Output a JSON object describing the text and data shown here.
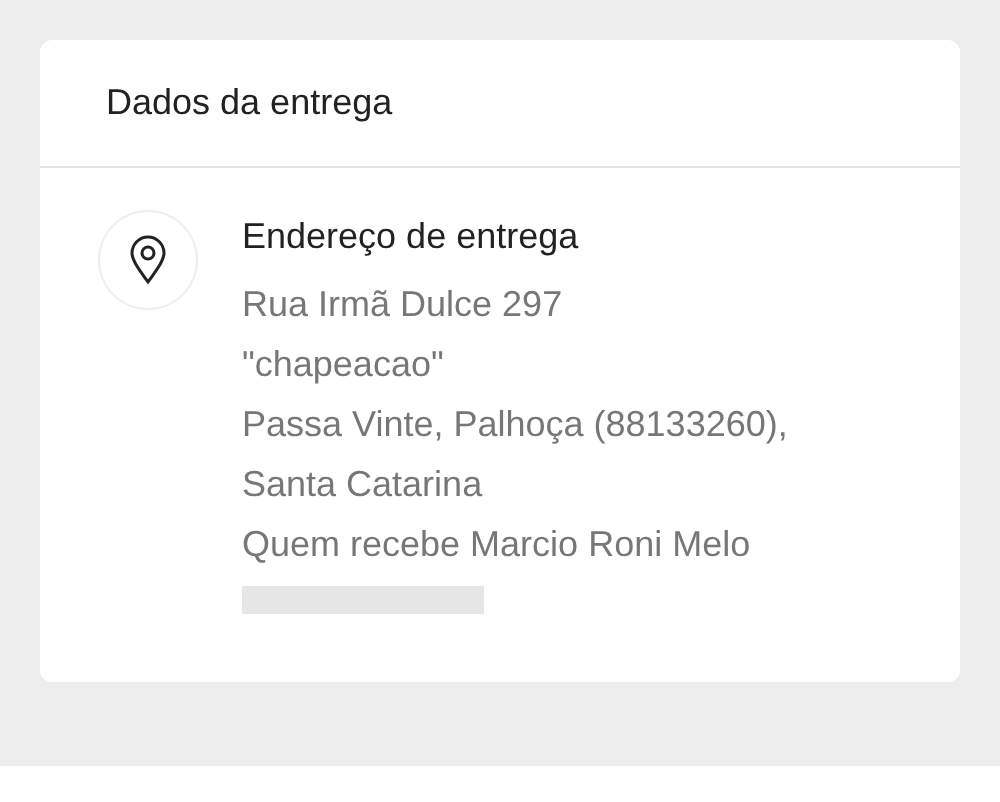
{
  "card": {
    "title": "Dados da entrega"
  },
  "address": {
    "heading": "Endereço de entrega",
    "lines": [
      "Rua Irmã Dulce 297",
      "\"chapeacao\"",
      "Passa Vinte, Palhoça (88133260),",
      "Santa Catarina",
      "Quem recebe Marcio Roni Melo"
    ],
    "redacted": true
  }
}
